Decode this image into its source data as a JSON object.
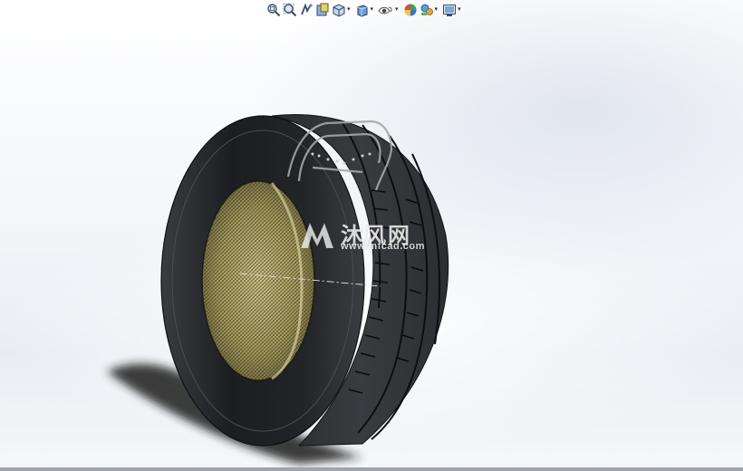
{
  "toolbar": {
    "items": [
      {
        "name": "zoom-to-fit-icon",
        "dropdown": false
      },
      {
        "name": "zoom-to-area-icon",
        "dropdown": false
      },
      {
        "name": "previous-view-icon",
        "dropdown": false
      },
      {
        "name": "section-view-icon",
        "dropdown": false
      },
      {
        "name": "view-orientation-icon",
        "dropdown": true
      },
      {
        "name": "display-style-icon",
        "dropdown": true
      },
      {
        "name": "hide-show-items-icon",
        "dropdown": true
      },
      {
        "name": "edit-appearance-icon",
        "dropdown": false
      },
      {
        "name": "apply-scene-icon",
        "dropdown": true
      },
      {
        "name": "view-settings-icon",
        "dropdown": true
      }
    ],
    "dropdown_glyph": "▾"
  },
  "watermark": {
    "brand": "沐风网",
    "url": "www.mfcad.com"
  },
  "colors": {
    "tire_dark": "#1b1c1e",
    "tire_mid": "#2e3033",
    "inner_liner": "#a49a5c",
    "shadow": "#2a2a2a"
  }
}
